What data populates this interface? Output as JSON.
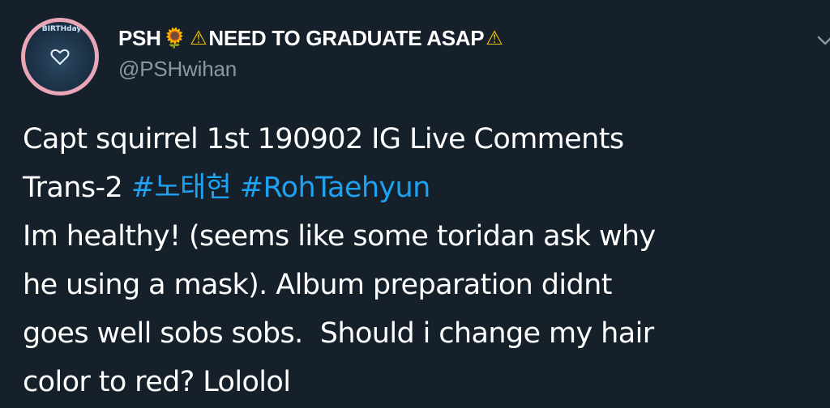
{
  "author": {
    "display_name_text": "PSH",
    "sunflower_emoji": "🌻",
    "warning_emoji_left": "⚠",
    "display_name_status": "NEED TO GRADUATE ASAP",
    "warning_emoji_right": "⚠",
    "handle": "@PSHwihan",
    "avatar_label": "BIRTHday"
  },
  "tweet": {
    "line1": "Capt squirrel 1st 190902 IG Live Comments",
    "line2_prefix": "Trans-2 ",
    "hashtag1": "#노태현",
    "space": " ",
    "hashtag2": "#RohTaehyun",
    "line3": "Im healthy! (seems like some toridan ask why",
    "line4": "he using a mask). Album preparation didnt",
    "line5": "goes well sobs sobs.  Should i change my hair",
    "line6": "color to red? Lololol"
  },
  "colors": {
    "background": "#15202b",
    "text": "#ffffff",
    "secondary_text": "#8899a6",
    "link": "#1da1f2"
  },
  "icons": {
    "avatar": "profile-avatar",
    "menu": "chevron-down-icon"
  }
}
